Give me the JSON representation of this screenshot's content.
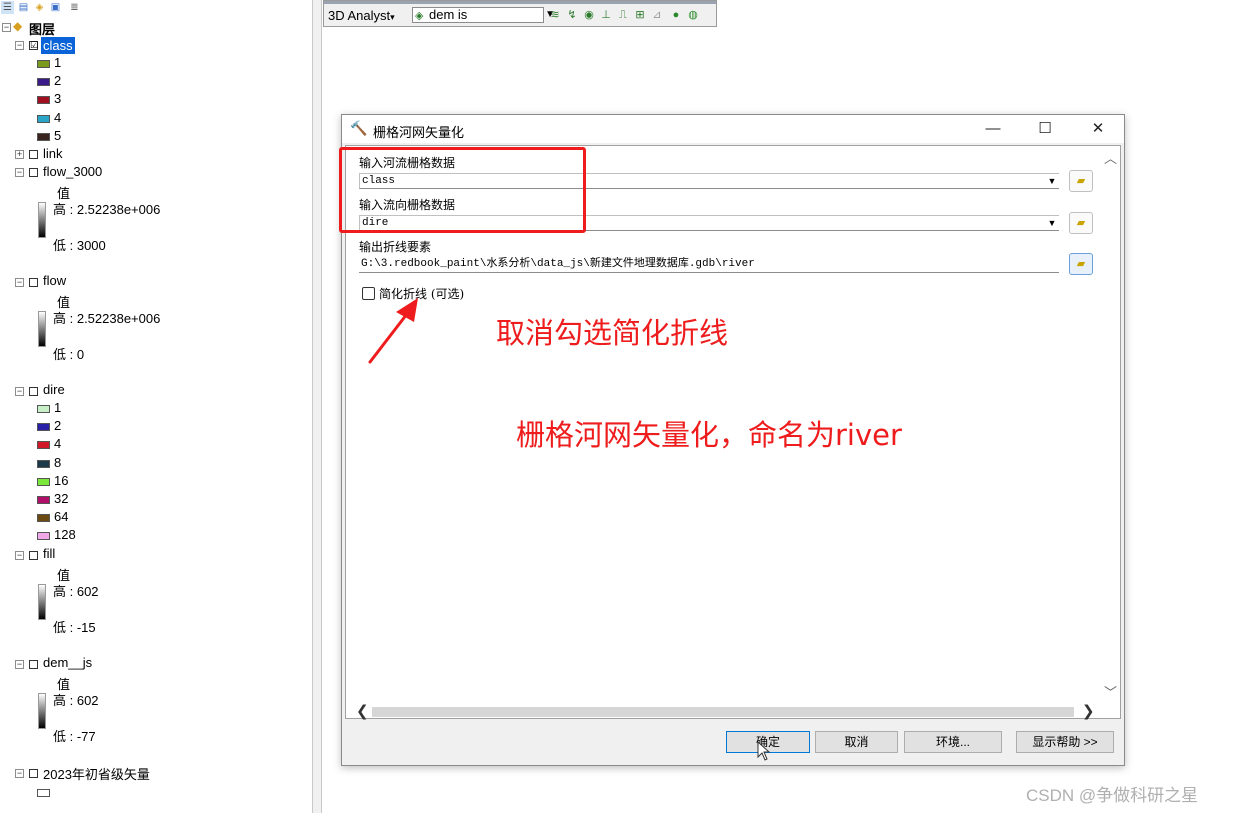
{
  "toc": {
    "root_label": "图层",
    "layers": {
      "class": {
        "name": "class",
        "checked": "☑",
        "expand": "−",
        "classes": [
          {
            "label": "1",
            "color": "#7a9a1e"
          },
          {
            "label": "2",
            "color": "#3b1a8a"
          },
          {
            "label": "3",
            "color": "#a01020"
          },
          {
            "label": "4",
            "color": "#2aa6c8"
          },
          {
            "label": "5",
            "color": "#3a2420"
          }
        ]
      },
      "link": {
        "name": "link",
        "expand": "+"
      },
      "flow_3000": {
        "name": "flow_3000",
        "expand": "−",
        "value_label": "值",
        "high": "高 : 2.52238e+006",
        "low": "低 : 3000"
      },
      "flow": {
        "name": "flow",
        "expand": "−",
        "value_label": "值",
        "high": "高 : 2.52238e+006",
        "low": "低 : 0"
      },
      "dire": {
        "name": "dire",
        "expand": "−",
        "classes": [
          {
            "label": "1",
            "color": "#c8f0c8"
          },
          {
            "label": "2",
            "color": "#2a20a8"
          },
          {
            "label": "4",
            "color": "#d01828"
          },
          {
            "label": "8",
            "color": "#1a3a4a"
          },
          {
            "label": "16",
            "color": "#7ae83a"
          },
          {
            "label": "32",
            "color": "#b0106a"
          },
          {
            "label": "64",
            "color": "#6a4a10"
          },
          {
            "label": "128",
            "color": "#f0a8e8"
          }
        ]
      },
      "fill": {
        "name": "fill",
        "expand": "−",
        "value_label": "值",
        "high": "高 : 602",
        "low": "低 : -15"
      },
      "dem_js": {
        "name": "dem__js",
        "expand": "−",
        "value_label": "值",
        "high": "高 : 602",
        "low": "低 : -77"
      },
      "province": {
        "name": "2023年初省级矢量",
        "expand": "−"
      }
    }
  },
  "toolbar3d": {
    "analyst_label": "3D Analyst",
    "menu_arrow": "▾",
    "layer_value": "dem   is",
    "layer_arrow": "▼"
  },
  "dialog": {
    "title": "栅格河网矢量化",
    "minimize": "—",
    "maximize": "☐",
    "close": "✕",
    "param1_label": "输入河流栅格数据",
    "param1_value": "class",
    "param2_label": "输入流向栅格数据",
    "param2_value": "dire",
    "param3_label": "输出折线要素",
    "param3_value": "G:\\3.redbook_paint\\水系分析\\data_js\\新建文件地理数据库.gdb\\river",
    "simplify_label": "简化折线 (可选)",
    "btn_ok": "确定",
    "btn_cancel": "取消",
    "btn_env": "环境...",
    "btn_help": "显示帮助 >>"
  },
  "annotations": {
    "note1": "取消勾选简化折线",
    "note2": "栅格河网矢量化，命名为river"
  },
  "watermark": "CSDN @争做科研之星"
}
